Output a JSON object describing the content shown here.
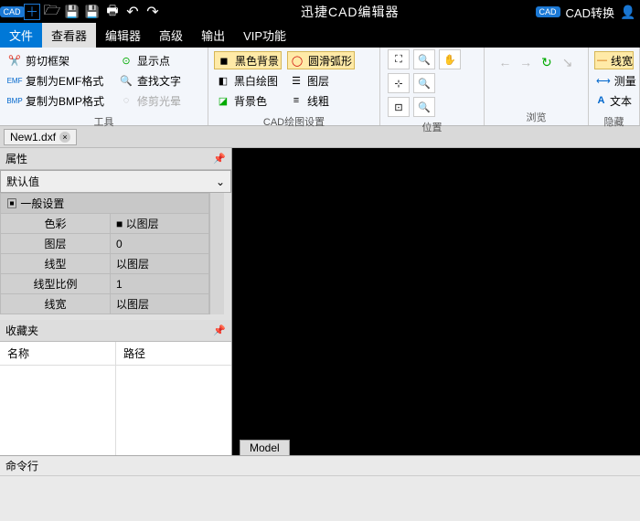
{
  "titlebar": {
    "app_title": "迅捷CAD编辑器",
    "cad_badge": "CAD",
    "convert_label": "CAD转换"
  },
  "tabs": {
    "file": "文件",
    "viewer": "查看器",
    "editor": "编辑器",
    "advanced": "高级",
    "output": "输出",
    "vip": "VIP功能"
  },
  "ribbon": {
    "tools": {
      "label": "工具",
      "crop": "剪切框架",
      "copy_emf": "复制为EMF格式",
      "copy_bmp": "复制为BMP格式",
      "show_point": "显示点",
      "find_text": "查找文字",
      "trim_halo": "修剪光晕"
    },
    "cad_settings": {
      "label": "CAD绘图设置",
      "black_bg": "黑色背景",
      "round_arc": "圆滑弧形",
      "bw_draw": "黑白绘图",
      "layers": "图层",
      "bg_color": "背景色",
      "lineweight": "线粗"
    },
    "position": {
      "label": "位置"
    },
    "browse": {
      "label": "浏览"
    },
    "hidden": {
      "label": "隐藏",
      "linewidth": "线宽",
      "measure": "测量",
      "text": "文本"
    }
  },
  "filetab": {
    "name": "New1.dxf"
  },
  "props": {
    "title": "属性",
    "defaults": "默认值",
    "section_general": "一般设置",
    "rows": {
      "color": {
        "label": "色彩",
        "value": "以图层"
      },
      "layer": {
        "label": "图层",
        "value": "0"
      },
      "linetype": {
        "label": "线型",
        "value": "以图层"
      },
      "ltscale": {
        "label": "线型比例",
        "value": "1"
      },
      "lineweight": {
        "label": "线宽",
        "value": "以图层"
      }
    }
  },
  "favorites": {
    "title": "收藏夹",
    "col_name": "名称",
    "col_path": "路径"
  },
  "model_tab": "Model",
  "cmdline": {
    "label": "命令行"
  }
}
